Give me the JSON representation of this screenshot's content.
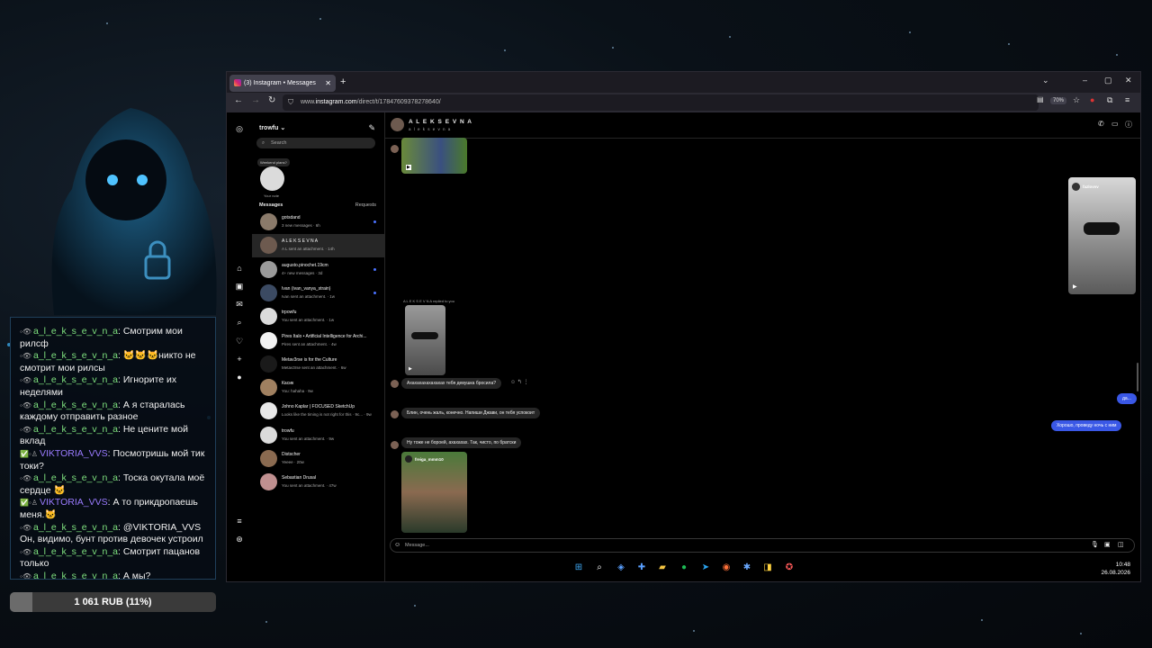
{
  "stream": {
    "chat": [
      {
        "badges": "◦👁",
        "user": "a_l_e_k_s_e_v_n_a",
        "variant": "a",
        "text": "Смотрим мои рилсф"
      },
      {
        "badges": "◦👁",
        "user": "a_l_e_k_s_e_v_n_a",
        "variant": "a",
        "text": "🐱🐱🐱никто не смотрит мои рилсы"
      },
      {
        "badges": "◦👁",
        "user": "a_l_e_k_s_e_v_n_a",
        "variant": "a",
        "text": "Игнорите их неделями"
      },
      {
        "badges": "◦👁",
        "user": "a_l_e_k_s_e_v_n_a",
        "variant": "a",
        "text": "А я старалась каждому отправить разное"
      },
      {
        "badges": "◦👁",
        "user": "a_l_e_k_s_e_v_n_a",
        "variant": "a",
        "text": "Не цените мой вклад"
      },
      {
        "badges": "✅◦♙",
        "user": "VIKTORIA_VVS",
        "variant": "v",
        "text": "Посмотришь мой тик токи?"
      },
      {
        "badges": "◦👁",
        "user": "a_l_e_k_s_e_v_n_a",
        "variant": "a",
        "text": "Тоска окутала моё сердце 🐱"
      },
      {
        "badges": "✅◦♙",
        "user": "VIKTORIA_VVS",
        "variant": "v",
        "text": "А то прикдропаешь меня.🐱"
      },
      {
        "badges": "◦👁",
        "user": "a_l_e_k_s_e_v_n_a",
        "variant": "a",
        "text": "@VIKTORIA_VVS Он, видимо, бунт против девочек устроил"
      },
      {
        "badges": "◦👁",
        "user": "a_l_e_k_s_e_v_n_a",
        "variant": "a",
        "text": "Смотрит пацанов только"
      },
      {
        "badges": "◦👁",
        "user": "a_l_e_k_s_e_v_n_a",
        "variant": "a",
        "text": "А мы?"
      }
    ],
    "donation": {
      "label": "1 061 RUB (11%)",
      "progress": 0.11
    }
  },
  "browser": {
    "tab_title": "(3) Instagram • Messages",
    "url_prefix": "www.",
    "url_host": "instagram.com",
    "url_path": "/direct/t/17847609378278640/",
    "zoom": "70%"
  },
  "ig": {
    "username": "trowfu ⌄",
    "search_placeholder": "Search",
    "note_bubble": "Weekend plans?",
    "note_label": "Your note",
    "messages_label": "Messages",
    "requests_label": "Requests",
    "threads": [
      {
        "name": "gotsdand",
        "preview": "3 new messages · 6h",
        "unread": true,
        "active": false,
        "avatar_color": "#8a7a6a"
      },
      {
        "name": "A L E K S E V N A",
        "preview": "A L sent an attachment. · 14h",
        "unread": false,
        "active": true,
        "avatar_color": "#6d5a4f"
      },
      {
        "name": "augusto.pinochet.19cm",
        "preview": "4+ new messages · 3d",
        "unread": true,
        "active": false,
        "avatar_color": "#9a9a9a"
      },
      {
        "name": "Ivan (ivan_vanya_strain)",
        "preview": "Ivan sent an attachment. · 1w",
        "unread": true,
        "active": false,
        "avatar_color": "#3b4a62"
      },
      {
        "name": "trpowfu",
        "preview": "You sent an attachment. · 1w",
        "unread": false,
        "active": false,
        "avatar_color": "#dbdbdb"
      },
      {
        "name": "Pires Italo • Artificial Intelligence for Archi...",
        "preview": "Pires sent an attachment. · 4w",
        "unread": false,
        "active": false,
        "avatar_color": "#f2f2f2"
      },
      {
        "name": "Metav3rse is for the Culture",
        "preview": "Metav3rse sent an attachment. · 6w",
        "unread": false,
        "active": false,
        "avatar_color": "#1a1a1a"
      },
      {
        "name": "Касик",
        "preview": "You: hahaha · 9w",
        "unread": false,
        "active": false,
        "avatar_color": "#a08060"
      },
      {
        "name": "Johno Kaplar | FOCUSED SketchUp",
        "preview": "Looks like the timing is not right for this · 9c... · 9w",
        "unread": false,
        "active": false,
        "avatar_color": "#e8e8e8"
      },
      {
        "name": "trowfu",
        "preview": "You sent an attachment. · 9w",
        "unread": false,
        "active": false,
        "avatar_color": "#dbdbdb"
      },
      {
        "name": "Distscher",
        "preview": "Yeeee · 20w",
        "unread": false,
        "active": false,
        "avatar_color": "#8a6a50"
      },
      {
        "name": "Sebastian Drusal",
        "preview": "You sent an attachment. · 47w",
        "unread": false,
        "active": false,
        "avatar_color": "#c09090"
      }
    ],
    "chat": {
      "name": "A L E K S E V N A",
      "sub": "a l e k s e v n a",
      "replied_label": "A L E K S E V N A replied to you",
      "reel_user": "fazlovvv",
      "reel2_user": "freiga_mmm10",
      "messages": [
        {
          "text": "Ахахахахахахахах тебя девушка бросила?",
          "mine": false
        },
        {
          "text": "да...",
          "mine": true
        },
        {
          "text": "Хорошо, проведу ночь с ним",
          "mine": true
        },
        {
          "text": "Блин, очень жаль, конечно. Напиши Джави, он тебя успокоит",
          "mine": false
        },
        {
          "text": "Ну тоже не бороей, ахахахах. Так, чисто, по братски",
          "mine": false
        }
      ],
      "composer_placeholder": "Message..."
    }
  },
  "taskbar": {
    "time": "10:48",
    "date": "26.08.2026"
  }
}
